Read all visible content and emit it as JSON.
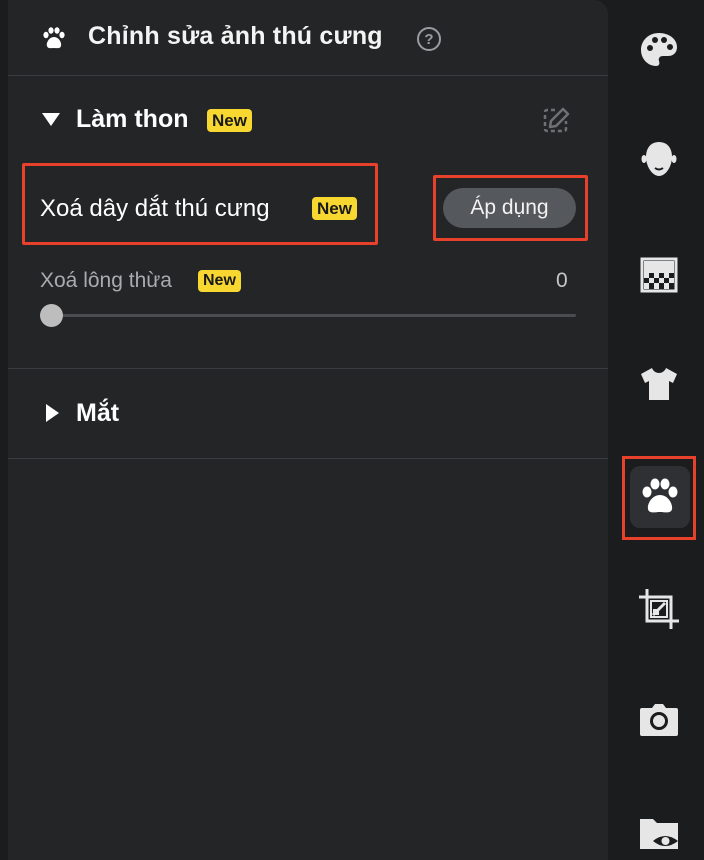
{
  "panel": {
    "title": "Chỉnh sửa ảnh thú cưng",
    "help_icon": "question-circle-icon",
    "title_icon": "paw-icon"
  },
  "section_slim": {
    "title": "Làm thon",
    "badge": "New",
    "expanded": true,
    "edit_icon": "edit-pencil-icon",
    "leash_removal": {
      "label": "Xoá dây dắt thú cưng",
      "badge": "New",
      "apply_label": "Áp dụng"
    },
    "fur_removal": {
      "label": "Xoá lông thừa",
      "badge": "New",
      "value": "0",
      "slider_fraction": 0
    }
  },
  "section_eyes": {
    "title": "Mắt",
    "expanded": false
  },
  "rail": {
    "tools": [
      {
        "icon": "palette-icon"
      },
      {
        "icon": "face-icon"
      },
      {
        "icon": "background-pattern-icon"
      },
      {
        "icon": "tshirt-icon"
      },
      {
        "icon": "paw-icon",
        "active": true
      },
      {
        "icon": "crop-icon"
      },
      {
        "icon": "camera-icon"
      },
      {
        "icon": "folder-eye-icon"
      }
    ]
  },
  "colors": {
    "highlight": "#e8412b",
    "badge": "#f7d730",
    "panel_bg": "#232527",
    "rail_bg": "#1b1c1e"
  }
}
